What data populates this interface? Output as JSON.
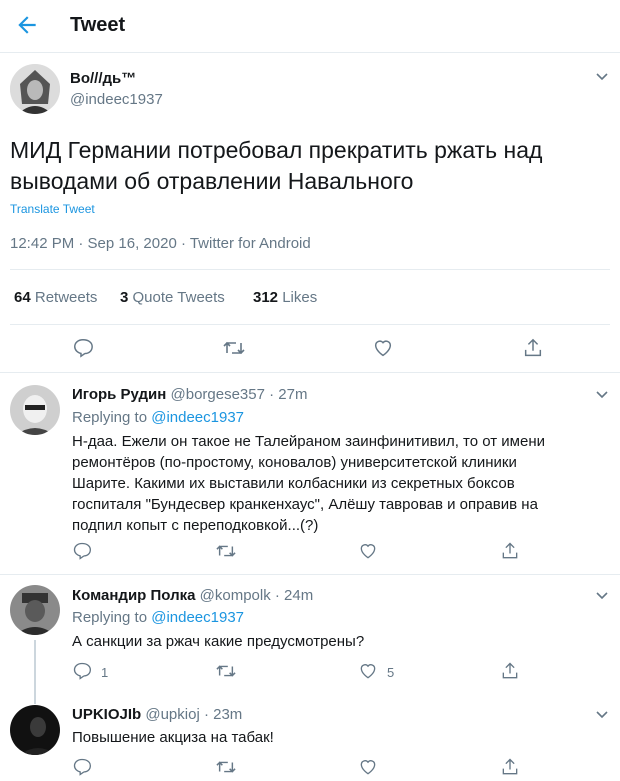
{
  "header": {
    "title": "Tweet"
  },
  "tweet": {
    "author_name": "Bo///дь™",
    "author_handle": "@indeec1937",
    "text_line1": "МИД Германии потребовал прекратить ржать над",
    "text_line2": "выводами об отравлении Навального",
    "translate": "Translate Tweet",
    "meta": "12:42 PM · Sep 16, 2020 · Twitter for Android",
    "stats": {
      "retweets_count": "64",
      "retweets_label": "Retweets",
      "quotes_count": "3",
      "quotes_label": "Quote Tweets",
      "likes_count": "312",
      "likes_label": "Likes"
    }
  },
  "replies": [
    {
      "name": "Игорь Рудин",
      "handle": "@borgese357",
      "time": "· 27m",
      "replying_prefix": "Replying to",
      "replying_to": "@indeec1937",
      "lines": [
        "Н-даа. Ежели он такое не Талейраном заинфинитивил, то от имени",
        "ремонтёров (по-простому, коновалов) университетской клиники",
        "Шарите. Какими их выставили колбасники из секретных боксов",
        "госпиталя \"Бундесвер кранкенхаус\", Алёшу тавровав и оправив на",
        "подпил копыт с переподковкой...(?)"
      ],
      "reply_count": "",
      "like_count": ""
    },
    {
      "name": "Командир Полка",
      "handle": "@kompolk",
      "time": "· 24m",
      "replying_prefix": "Replying to",
      "replying_to": "@indeec1937",
      "lines": [
        "А санкции за ржач какие предусмотрены?"
      ],
      "reply_count": "1",
      "like_count": "5"
    },
    {
      "name": "UPKIOJIb",
      "handle": "@upkioj",
      "time": "· 23m",
      "lines": [
        "Повышение акциза на табак!"
      ],
      "reply_count": "",
      "like_count": ""
    }
  ],
  "colors": {
    "accent": "#1b95e0",
    "muted": "#657786",
    "divider": "#e6ecf0",
    "text": "#14171a"
  },
  "icons": [
    "back-arrow-icon",
    "chevron-down-icon",
    "reply-icon",
    "retweet-icon",
    "like-icon",
    "share-icon"
  ]
}
